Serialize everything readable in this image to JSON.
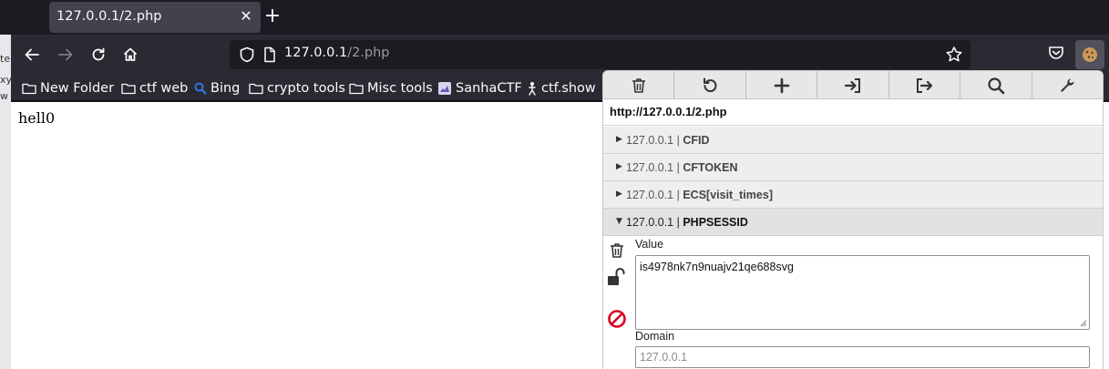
{
  "left_strip": {
    "fragments": [
      "te",
      "xy",
      "w"
    ]
  },
  "tab": {
    "title": "127.0.0.1/2.php",
    "close_glyph": "✕"
  },
  "new_tab_glyph": "+",
  "urlbar": {
    "host": "127.0.0.1",
    "path": "/2.php"
  },
  "bookmarks": [
    {
      "label": "New Folder",
      "icon": "folder-icon"
    },
    {
      "label": "ctf web",
      "icon": "folder-icon"
    },
    {
      "label": "Bing",
      "icon": "search-icon"
    },
    {
      "label": "crypto tools",
      "icon": "folder-icon"
    },
    {
      "label": "Misc tools",
      "icon": "folder-icon"
    },
    {
      "label": "SanhaCTF",
      "icon": "site-favicon"
    },
    {
      "label": "ctf.show",
      "icon": "site-favicon"
    }
  ],
  "page": {
    "text": "hell0"
  },
  "cookie_editor": {
    "toolbar": [
      "delete-all-icon",
      "undo-icon",
      "add-icon",
      "import-icon",
      "export-icon",
      "search-icon",
      "settings-icon"
    ],
    "url": "http://127.0.0.1/2.php",
    "cookies": [
      {
        "domain": "127.0.0.1",
        "separator": " | ",
        "name": "CFID",
        "open": false
      },
      {
        "domain": "127.0.0.1",
        "separator": " | ",
        "name": "CFTOKEN",
        "open": false
      },
      {
        "domain": "127.0.0.1",
        "separator": " | ",
        "name": "ECS[visit_times]",
        "open": false
      },
      {
        "domain": "127.0.0.1",
        "separator": " | ",
        "name": "PHPSESSID",
        "open": true
      }
    ],
    "detail": {
      "value_label": "Value",
      "value": "is4978nk7n9nuajv21qe688svg",
      "domain_label": "Domain",
      "domain": "127.0.0.1"
    }
  },
  "colors": {
    "chrome_dark": "#1c1b22",
    "toolbar": "#2b2a33",
    "tab_active": "#42414d",
    "block_red": "#d70022"
  }
}
